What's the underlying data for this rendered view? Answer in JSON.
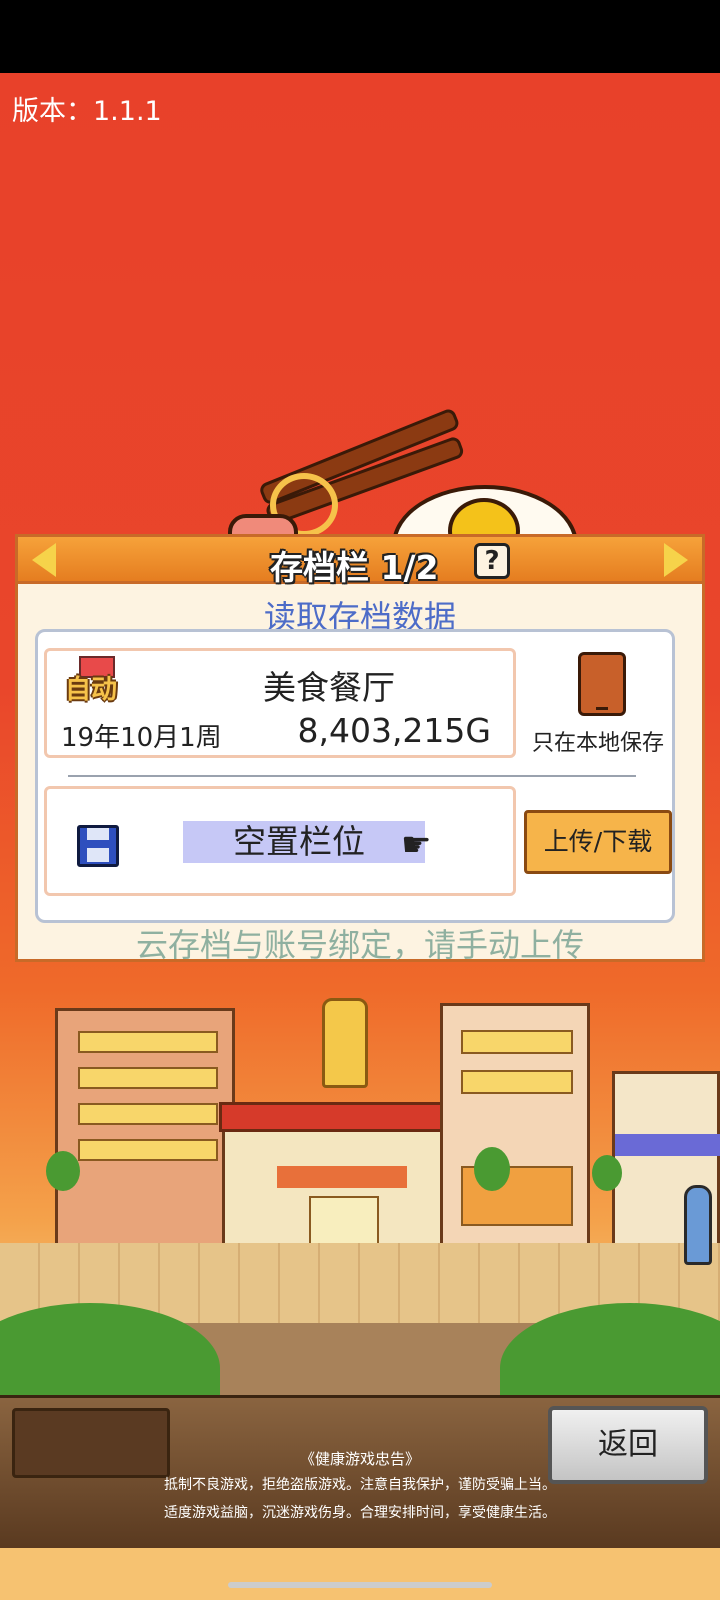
{
  "app": {
    "version_label": "版本：1.1.1"
  },
  "save_panel": {
    "title": "存档栏 1/2",
    "help_icon": "?",
    "subtitle": "读取存档数据",
    "slots": [
      {
        "badge": "自动",
        "name": "美食餐厅",
        "date": "19年10月1周",
        "money": "8,403,215G"
      },
      {
        "name": "空置栏位"
      }
    ],
    "local_only_label": "只在本地保存",
    "upload_button_label": "上传/下载",
    "cloud_note": "云存档与账号绑定，请手动上传"
  },
  "footer": {
    "back_button_label": "返回",
    "health_title": "《健康游戏忠告》",
    "health_line_1": "抵制不良游戏，拒绝盗版游戏。注意自我保护，谨防受骗上当。",
    "health_line_2": "适度游戏益脑，沉迷游戏伤身。合理安排时间，享受健康生活。"
  },
  "colors": {
    "background_red": "#e8412a",
    "panel_orange": "#e57d20",
    "subtitle_blue": "#4d6cc8",
    "empty_highlight": "#c6c8f6",
    "upload_button": "#f6b44a"
  },
  "icons": {
    "left_arrow": "arrow-left-icon",
    "right_arrow": "arrow-right-icon",
    "help": "question-icon",
    "auto_save": "auto-save-icon",
    "floppy": "floppy-disk-icon",
    "hand": "pointing-hand-icon",
    "phone": "phone-icon"
  }
}
